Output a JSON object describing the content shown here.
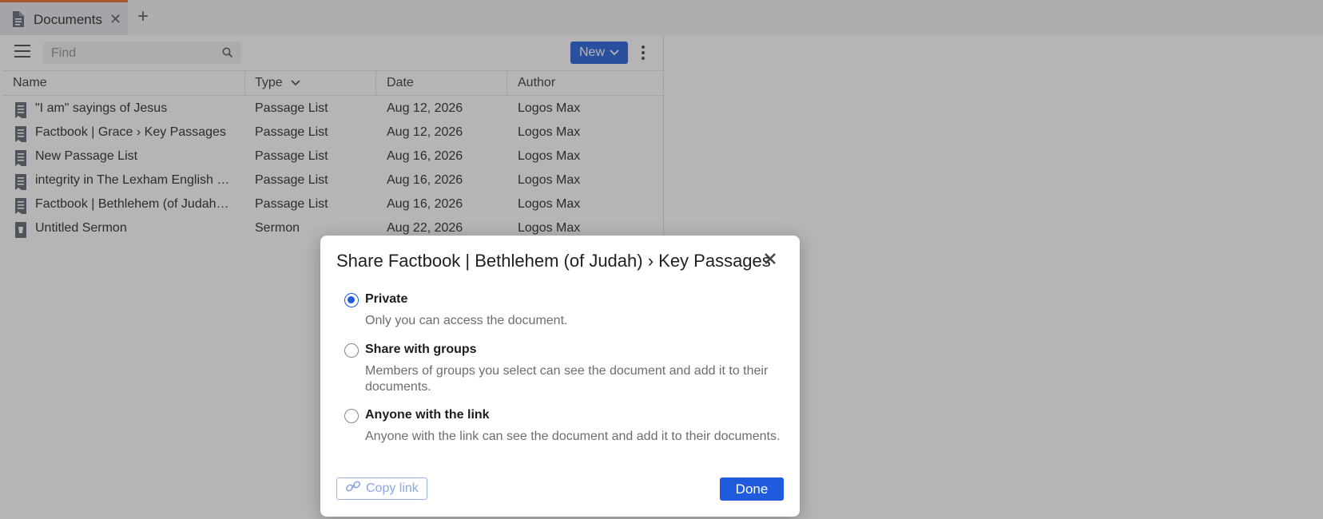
{
  "tab": {
    "title": "Documents",
    "close_glyph": "✕",
    "add_glyph": "+"
  },
  "toolbar": {
    "find_placeholder": "Find",
    "new_label": "New",
    "menu_icon": "hamburger-icon",
    "more_icon": "kebab-icon"
  },
  "columns": {
    "name": "Name",
    "type": "Type",
    "date": "Date",
    "author": "Author"
  },
  "documents": [
    {
      "name": "\"I am\" sayings of Jesus",
      "type": "Passage List",
      "date": "Aug 12, 2026",
      "author": "Logos Max",
      "icon": "passage-list-icon"
    },
    {
      "name": "Factbook | Grace › Key Passages",
      "type": "Passage List",
      "date": "Aug 12, 2026",
      "author": "Logos Max",
      "icon": "passage-list-icon"
    },
    {
      "name": "New Passage List",
      "type": "Passage List",
      "date": "Aug 16, 2026",
      "author": "Logos Max",
      "icon": "passage-list-icon"
    },
    {
      "name": "integrity in The Lexham English …",
      "type": "Passage List",
      "date": "Aug 16, 2026",
      "author": "Logos Max",
      "icon": "passage-list-icon"
    },
    {
      "name": "Factbook | Bethlehem (of Judah…",
      "type": "Passage List",
      "date": "Aug 16, 2026",
      "author": "Logos Max",
      "icon": "passage-list-icon"
    },
    {
      "name": "Untitled Sermon",
      "type": "Sermon",
      "date": "Aug 22, 2026",
      "author": "Logos Max",
      "icon": "sermon-icon"
    }
  ],
  "dialog": {
    "title": "Share Factbook | Bethlehem (of Judah) › Key Passages",
    "options": [
      {
        "label": "Private",
        "description": "Only you can access the document.",
        "selected": true
      },
      {
        "label": "Share with groups",
        "description": "Members of groups you select can see the document and add it to their documents.",
        "selected": false
      },
      {
        "label": "Anyone with the link",
        "description": "Anyone with the link can see the document and add it to their documents.",
        "selected": false
      }
    ],
    "copy_link_label": "Copy link",
    "done_label": "Done"
  },
  "colors": {
    "accent": "#1f5bdc",
    "tab_highlight": "#e86a2c"
  }
}
